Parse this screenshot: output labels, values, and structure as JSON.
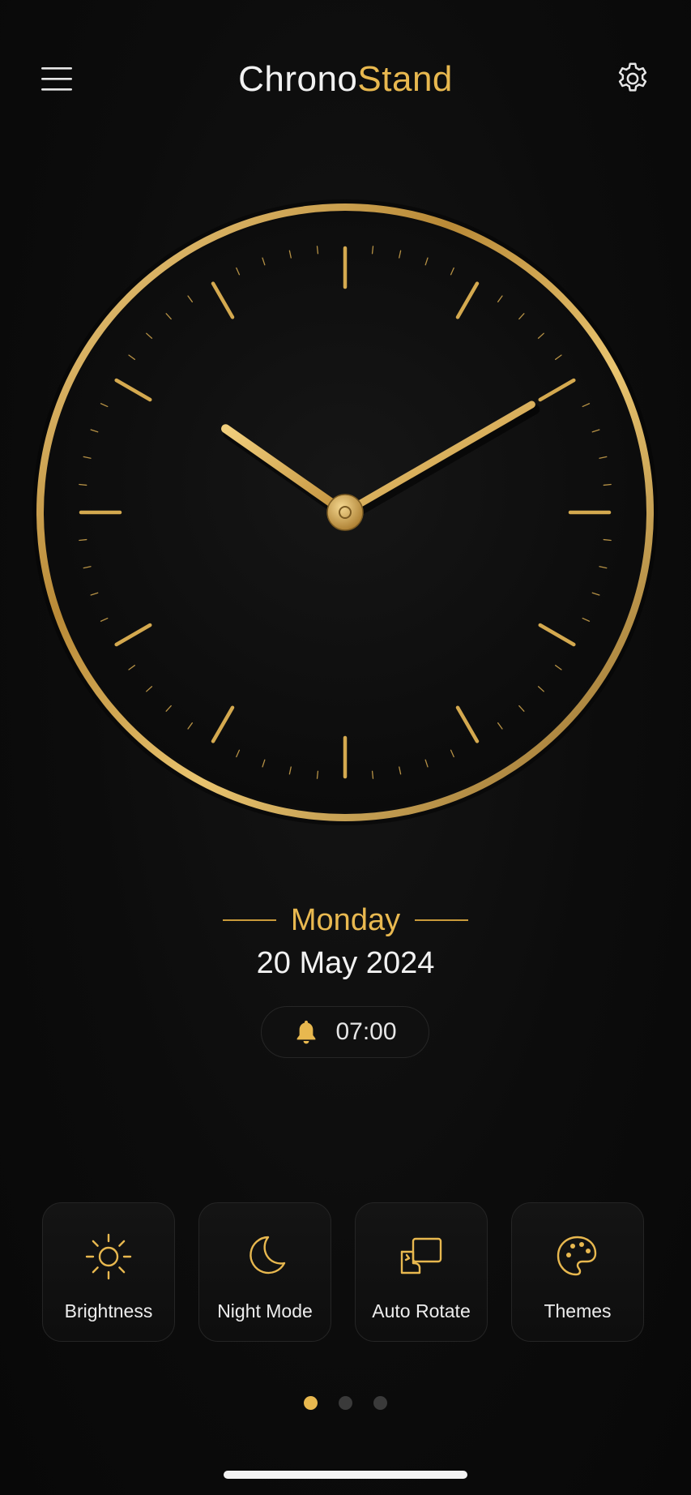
{
  "app": {
    "title_part1": "Chrono",
    "title_part2": "Stand",
    "accent_color": "#e8b84f",
    "background_color": "#0b0b0b"
  },
  "header": {
    "menu_icon": "hamburger-menu-icon",
    "settings_icon": "gear-icon"
  },
  "clock": {
    "hour": 10,
    "minute": 10,
    "face_color": "#0d0d0d",
    "ring_color": "#d4a94f",
    "hand_color": "#e6bd62"
  },
  "date_info": {
    "day": "Monday",
    "date": "20 May 2024"
  },
  "alarm": {
    "icon": "bell-icon",
    "time": "07:00"
  },
  "quick_actions": [
    {
      "label": "Brightness",
      "icon": "sun-icon"
    },
    {
      "label": "Night Mode",
      "icon": "moon-icon"
    },
    {
      "label": "Auto Rotate",
      "icon": "rotate-screen-icon"
    },
    {
      "label": "Themes",
      "icon": "palette-icon"
    }
  ],
  "pager": {
    "count": 3,
    "active_index": 0
  }
}
